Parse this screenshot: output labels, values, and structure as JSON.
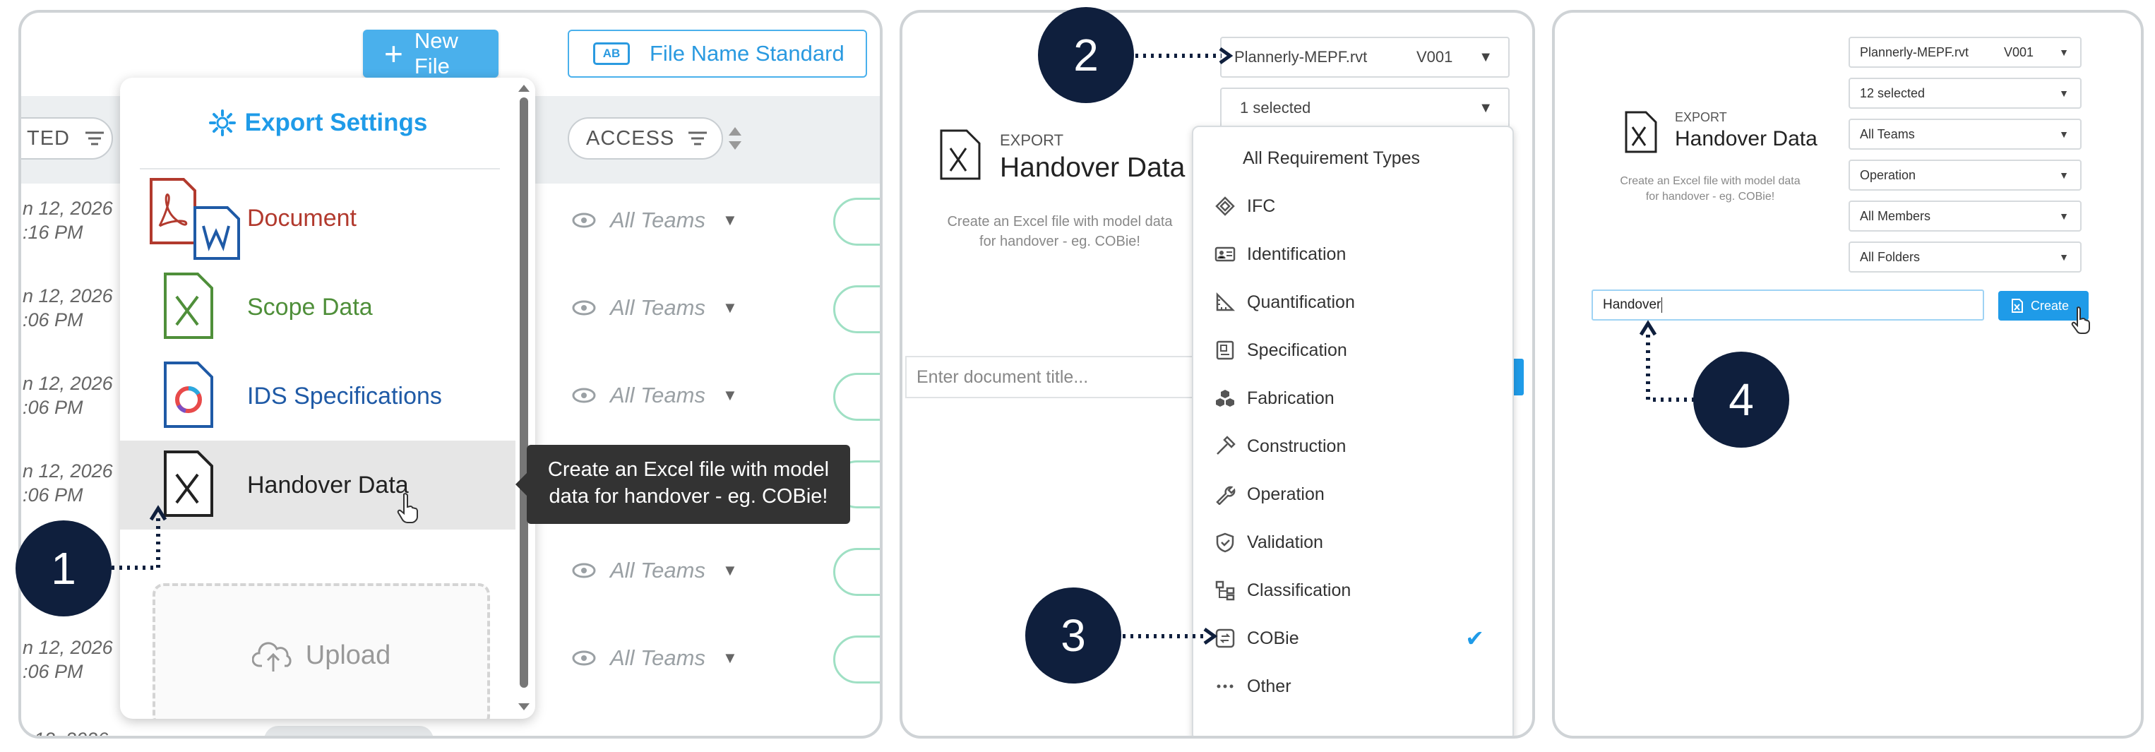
{
  "panel1": {
    "toolbar": {
      "new_file_label": "New File",
      "file_name_standard_label": "File Name Standard",
      "ab_icon_text": "AB"
    },
    "columns": {
      "created_label": "TED",
      "access_label": "ACCESS"
    },
    "rows": [
      {
        "date": "n 12, 2026",
        "time": ":16 PM",
        "access": "All Teams"
      },
      {
        "date": "n 12, 2026",
        "time": ":06 PM",
        "access": "All Teams"
      },
      {
        "date": "n 12, 2026",
        "time": ":06 PM",
        "access": "All Teams"
      },
      {
        "date": "n 12, 2026",
        "time": ":06 PM",
        "access": ""
      },
      {
        "date": "",
        "time": "",
        "access": "All Teams"
      },
      {
        "date": "n 12, 2026",
        "time": ":06 PM",
        "access": "All Teams"
      },
      {
        "date": "12, 2026",
        "time": "",
        "access": ""
      }
    ],
    "menu": {
      "title": "Export Settings",
      "items": [
        {
          "label": "Document",
          "color": "#b23a2e"
        },
        {
          "label": "Scope Data",
          "color": "#4f8f3a"
        },
        {
          "label": "IDS Specifications",
          "color": "#1f5aa6"
        },
        {
          "label": "Handover Data",
          "color": "#222222"
        }
      ],
      "upload_label": "Upload"
    },
    "tooltip": {
      "line1": "Create an Excel file with model",
      "line2": "data for handover - eg. COBie!"
    },
    "step": "1"
  },
  "panel2": {
    "step_top": "2",
    "step_bottom": "3",
    "model_select": {
      "file": "Plannerly-MEPF.rvt",
      "version": "V001"
    },
    "requirement_select": {
      "value": "1 selected"
    },
    "export_label": "EXPORT",
    "export_title": "Handover Data",
    "description_line1": "Create an Excel file with model data",
    "description_line2": "for handover - eg. COBie!",
    "title_placeholder": "Enter document title...",
    "dropdown": {
      "header": "All Requirement Types",
      "items": [
        {
          "label": "IFC",
          "icon": "ifc-icon"
        },
        {
          "label": "Identification",
          "icon": "id-card-icon"
        },
        {
          "label": "Quantification",
          "icon": "ruler-triangle-icon"
        },
        {
          "label": "Specification",
          "icon": "spec-sheet-icon"
        },
        {
          "label": "Fabrication",
          "icon": "cubes-icon"
        },
        {
          "label": "Construction",
          "icon": "hammer-icon"
        },
        {
          "label": "Operation",
          "icon": "wrench-icon"
        },
        {
          "label": "Validation",
          "icon": "shield-check-icon"
        },
        {
          "label": "Classification",
          "icon": "hierarchy-icon"
        },
        {
          "label": "COBie",
          "icon": "cobie-icon",
          "checked": true
        },
        {
          "label": "Other",
          "icon": "ellipsis-icon"
        }
      ]
    }
  },
  "panel3": {
    "step": "4",
    "export_label": "EXPORT",
    "export_title": "Handover Data",
    "description_line1": "Create an Excel file with model data",
    "description_line2": "for handover - eg. COBie!",
    "selects": [
      {
        "value": "Plannerly-MEPF.rvt",
        "version": "V001"
      },
      {
        "value": "12 selected"
      },
      {
        "value": "All Teams"
      },
      {
        "value": "Operation"
      },
      {
        "value": "All Members"
      },
      {
        "value": "All Folders"
      }
    ],
    "title_input_value": "Handover",
    "create_label": "Create"
  },
  "colors": {
    "accent": "#1f9be8",
    "badge": "#0f1f3d",
    "new_file": "#4ab0ec"
  }
}
